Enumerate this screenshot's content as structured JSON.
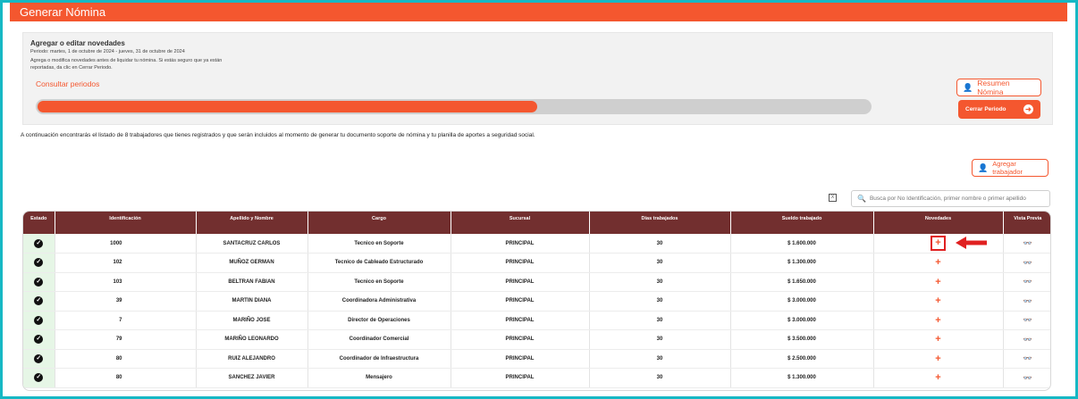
{
  "header": {
    "title": "Generar Nómina"
  },
  "panel": {
    "title": "Agregar o editar novedades",
    "period": "Periodo: martes, 1 de octubre de 2024 - jueves, 31 de octubre de 2024",
    "help": "Agrega o modifica novedades antes de liquidar tu nómina. Si estás seguro que ya están reportadas, da clic en Cerrar Periodo.",
    "consult_link": "Consultar periodos",
    "progress": 0.6,
    "resumen_label": "Resumen Nómina",
    "cerrar_label": "Cerrar Periodo"
  },
  "info_text": "A continuación encontrarás el listado de 8 trabajadores que tienes registrados y que serán incluidos al momento de generar tu documento soporte de nómina y tu planilla de aportes a seguridad social.",
  "agregar_label": "Agregar trabajador",
  "search": {
    "placeholder": "Busca por No Identificación, primer nombre o primer apellido"
  },
  "accent": "#f4572f",
  "table_header_color": "#722f2f",
  "table": {
    "headers": [
      "Estado",
      "Identificación",
      "Apellido y Nombre",
      "Cargo",
      "Sucursal",
      "Días trabajados",
      "Sueldo trabajado",
      "Novedades",
      "Vista Previa"
    ],
    "rows": [
      {
        "id": "1000",
        "name": "SANTACRUZ CARLOS",
        "cargo": "Tecnico en Soporte",
        "sucursal": "PRINCIPAL",
        "dias": "30",
        "sueldo": "$ 1.600.000"
      },
      {
        "id": "102",
        "name": "MUÑOZ GERMAN",
        "cargo": "Tecnico de Cableado Estructurado",
        "sucursal": "PRINCIPAL",
        "dias": "30",
        "sueldo": "$ 1.300.000"
      },
      {
        "id": "103",
        "name": "BELTRAN FABIAN",
        "cargo": "Tecnico en Soporte",
        "sucursal": "PRINCIPAL",
        "dias": "30",
        "sueldo": "$ 1.650.000"
      },
      {
        "id": "39",
        "name": "MARTIN DIANA",
        "cargo": "Coordinadora Administrativa",
        "sucursal": "PRINCIPAL",
        "dias": "30",
        "sueldo": "$ 3.000.000"
      },
      {
        "id": "7",
        "name": "MARIÑO JOSE",
        "cargo": "Director de Operaciones",
        "sucursal": "PRINCIPAL",
        "dias": "30",
        "sueldo": "$ 3.000.000"
      },
      {
        "id": "79",
        "name": "MARIÑO LEONARDO",
        "cargo": "Coordinador Comercial",
        "sucursal": "PRINCIPAL",
        "dias": "30",
        "sueldo": "$ 3.500.000"
      },
      {
        "id": "80",
        "name": "RUIZ ALEJANDRO",
        "cargo": "Coordinador de Infraestructura",
        "sucursal": "PRINCIPAL",
        "dias": "30",
        "sueldo": "$ 2.500.000"
      },
      {
        "id": "80",
        "name": "SANCHEZ JAVIER",
        "cargo": "Mensajero",
        "sucursal": "PRINCIPAL",
        "dias": "30",
        "sueldo": "$ 1.300.000"
      }
    ]
  },
  "icons": {
    "check": "✓",
    "plus": "+",
    "glasses": "👓",
    "user_plus": "👤",
    "arrow_right": "➜",
    "search": "🔍",
    "excel": "X"
  }
}
